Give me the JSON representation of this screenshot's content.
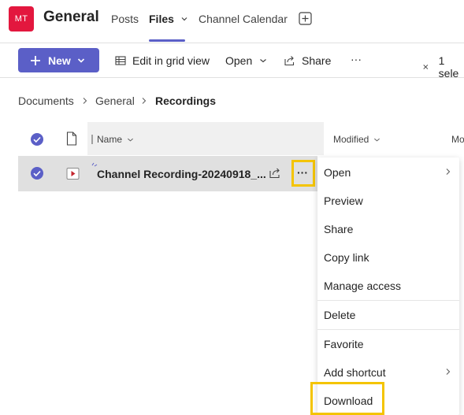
{
  "header": {
    "avatar_initials": "MT",
    "channel_name": "General",
    "tabs": [
      {
        "label": "Posts"
      },
      {
        "label": "Files"
      },
      {
        "label": "Channel Calendar"
      }
    ],
    "active_tab": "Files"
  },
  "toolbar": {
    "new_label": "New",
    "edit_grid_label": "Edit in grid view",
    "open_label": "Open",
    "share_label": "Share",
    "more_label": "···",
    "selection_label": "1 sele"
  },
  "breadcrumb": [
    "Documents",
    "General",
    "Recordings"
  ],
  "columns": {
    "name": "Name",
    "modified": "Modified",
    "modified_by": "Mo"
  },
  "rows": [
    {
      "name": "Channel Recording-20240918_...",
      "selected": true
    }
  ],
  "context_menu": {
    "items": [
      {
        "label": "Open",
        "submenu": true
      },
      {
        "label": "Preview",
        "submenu": false
      },
      {
        "label": "Share",
        "submenu": false
      },
      {
        "label": "Copy link",
        "submenu": false
      },
      {
        "label": "Manage access",
        "submenu": false
      },
      {
        "label": "Delete",
        "submenu": false
      },
      {
        "label": "Favorite",
        "submenu": false
      },
      {
        "label": "Add shortcut",
        "submenu": true
      },
      {
        "label": "Download",
        "submenu": false
      }
    ]
  },
  "colors": {
    "brand": "#5b5fc7",
    "avatar": "#e3173e",
    "highlight": "#f4c400",
    "row_selected": "#e0e0e0"
  }
}
